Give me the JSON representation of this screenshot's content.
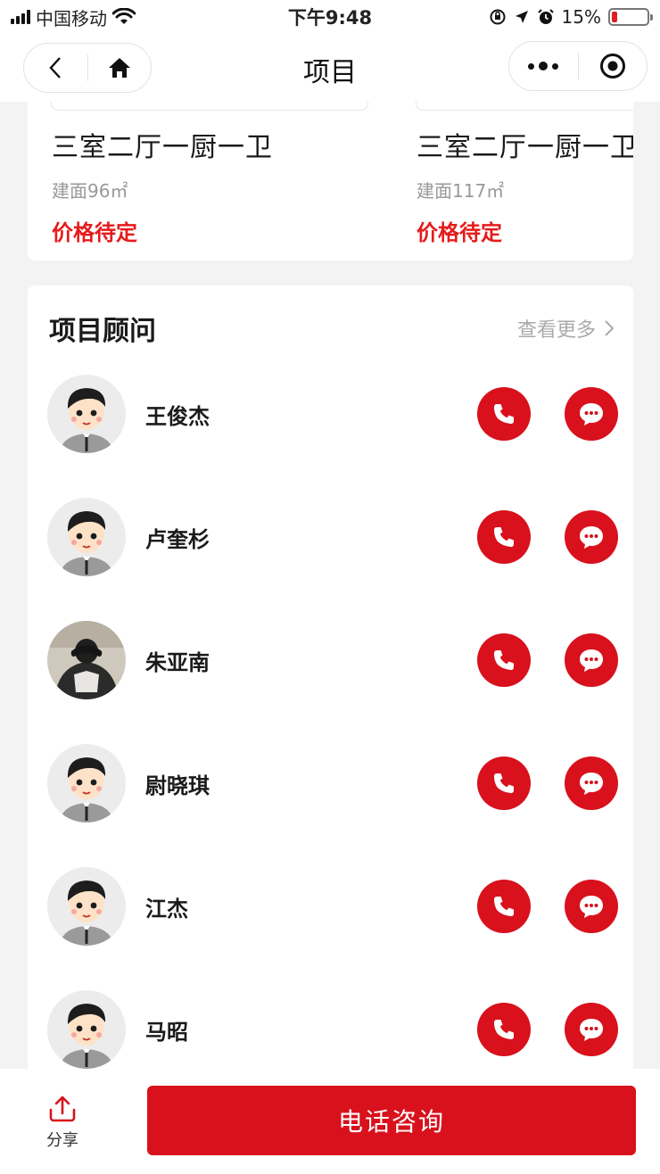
{
  "status_bar": {
    "carrier": "中国移动",
    "time": "下午9:48",
    "battery": "15%",
    "battery_level": 0.15
  },
  "nav": {
    "title": "项目"
  },
  "floor_plans": [
    {
      "name": "三室二厅一厨一卫",
      "area": "建面96㎡",
      "price": "价格待定"
    },
    {
      "name": "三室二厅一厨一卫",
      "area": "建面117㎡",
      "price": "价格待定"
    }
  ],
  "advisors": {
    "title": "项目顾问",
    "more": "查看更多",
    "items": [
      {
        "name": "王俊杰",
        "avatar": "cartoon"
      },
      {
        "name": "卢奎杉",
        "avatar": "cartoon"
      },
      {
        "name": "朱亚南",
        "avatar": "photo"
      },
      {
        "name": "尉晓琪",
        "avatar": "cartoon"
      },
      {
        "name": "江杰",
        "avatar": "cartoon"
      },
      {
        "name": "马昭",
        "avatar": "cartoon"
      }
    ]
  },
  "bottom_bar": {
    "share_label": "分享",
    "call_label": "电话咨询"
  },
  "colors": {
    "accent": "#d8111c",
    "price": "#e51b1b"
  }
}
